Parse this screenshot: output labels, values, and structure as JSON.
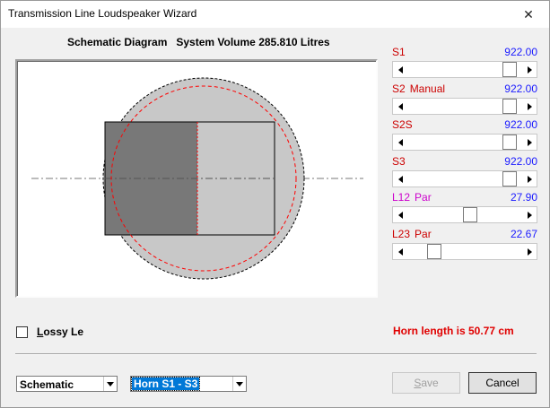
{
  "window": {
    "title": "Transmission Line Loudspeaker Wizard",
    "close_glyph": "✕"
  },
  "diagram": {
    "caption": "Schematic Diagram   System Volume 285.810 Litres"
  },
  "sliders": [
    {
      "label": "S1",
      "suffix": "",
      "value": "922.00",
      "position": 0.95,
      "label_color": "#cc0000"
    },
    {
      "label": "S2",
      "suffix": "Manual",
      "value": "922.00",
      "position": 0.95,
      "label_color": "#cc0000"
    },
    {
      "label": "S2S",
      "suffix": "",
      "value": "922.00",
      "position": 0.95,
      "label_color": "#cc0000"
    },
    {
      "label": "S3",
      "suffix": "",
      "value": "922.00",
      "position": 0.95,
      "label_color": "#cc0000"
    },
    {
      "label": "L12",
      "suffix": "Par",
      "value": "27.90",
      "position": 0.55,
      "label_color": "#cc00cc"
    },
    {
      "label": "L23",
      "suffix": "Par",
      "value": "22.67",
      "position": 0.2,
      "label_color": "#cc0000"
    }
  ],
  "options": {
    "lossy_label_u": "L",
    "lossy_label_rest": "ossy Le",
    "lossy_checked": false
  },
  "status": {
    "horn_length": "Horn length is 50.77 cm"
  },
  "controls": {
    "view_select": "Schematic",
    "section_select": "Horn S1 - S3",
    "save_label_u": "S",
    "save_label_rest": "ave",
    "cancel_label": "Cancel"
  }
}
